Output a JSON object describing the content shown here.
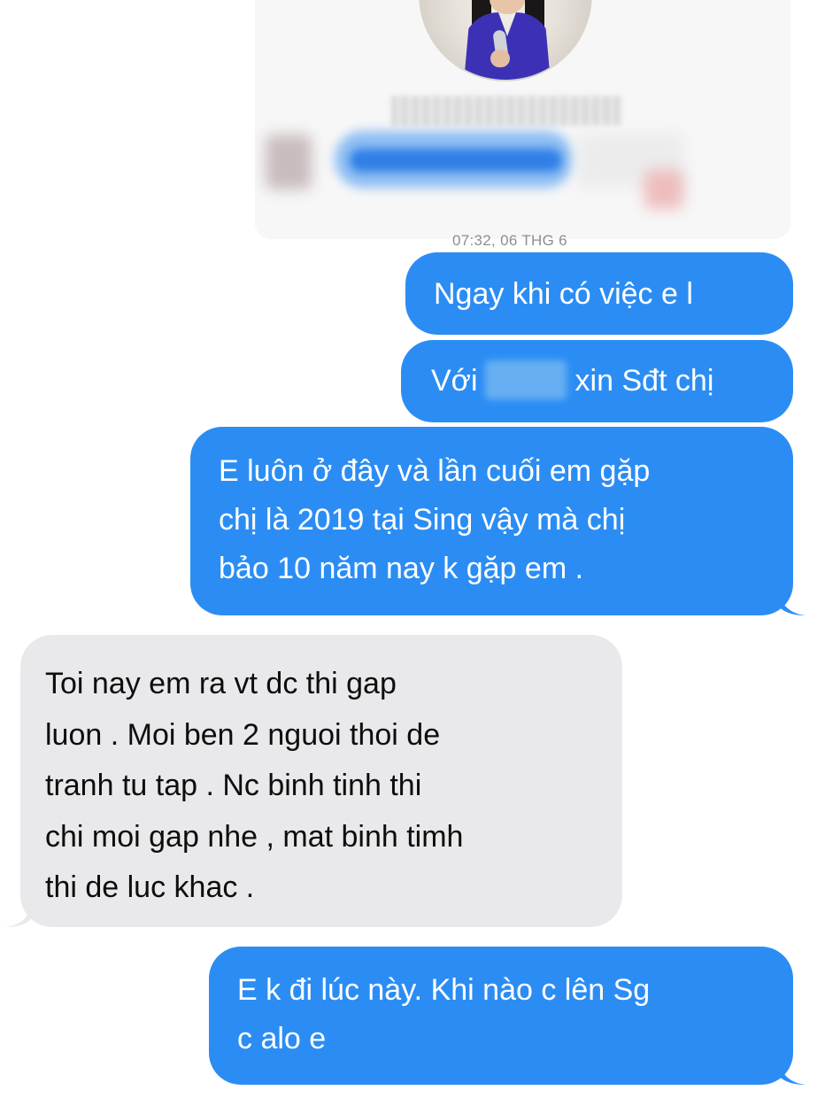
{
  "conversation": {
    "timestamp": "07:32, 06 THG 6",
    "messages": [
      {
        "direction": "outgoing",
        "lines": [
          "Ngay khi có việc e l"
        ]
      },
      {
        "direction": "outgoing",
        "prefix": "Với",
        "suffix": "xin Sđt chị"
      },
      {
        "direction": "outgoing",
        "lines": [
          "E luôn ở đây và lần cuối em gặp",
          "chị là 2019 tại Sing vậy mà chị",
          "bảo 10 năm nay  k gặp em ."
        ]
      },
      {
        "direction": "incoming",
        "lines": [
          "Toi nay em ra vt dc thi gap",
          "luon . Moi ben 2 nguoi thoi de",
          "tranh tu tap . Nc binh tinh thi",
          "chi moi gap nhe , mat binh timh",
          "thi de luc khac ."
        ]
      },
      {
        "direction": "outgoing",
        "lines": [
          "E k đi lúc này. Khi nào c lên Sg",
          "c alo e"
        ]
      }
    ]
  },
  "colors": {
    "outgoing_bubble": "#2b8df4",
    "incoming_bubble": "#e9e9eb",
    "background": "#ffffff",
    "timestamp_text": "#8e8e93"
  },
  "icons": [
    "contact-avatar"
  ]
}
